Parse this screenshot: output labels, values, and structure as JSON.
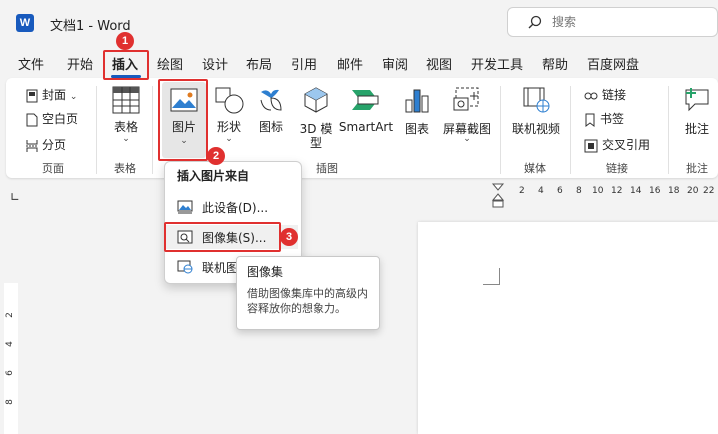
{
  "app": {
    "logo_letter": "W",
    "title": "文档1  -  Word",
    "search_placeholder": "搜索"
  },
  "tabs": [
    "文件",
    "开始",
    "插入",
    "绘图",
    "设计",
    "布局",
    "引用",
    "邮件",
    "审阅",
    "视图",
    "开发工具",
    "帮助",
    "百度网盘"
  ],
  "active_tab": "插入",
  "ribbon": {
    "pages_group": {
      "cover": "封面",
      "blank": "空白页",
      "break": "分页",
      "label": "页面"
    },
    "table_group": {
      "table": "表格",
      "label": "表格"
    },
    "illustrations_group": {
      "pictures": "图片",
      "shapes": "形状",
      "icons": "图标",
      "model3d_line1": "3D 模",
      "model3d_line2": "型",
      "smartart": "SmartArt",
      "chart": "图表",
      "screenshot": "屏幕截图",
      "label": "插图"
    },
    "media_group": {
      "online_video": "联机视频",
      "label": "媒体"
    },
    "links_group": {
      "link": "链接",
      "bookmark": "书签",
      "cross_ref": "交叉引用",
      "label": "链接"
    },
    "comments_group": {
      "comment": "批注",
      "label": "批注"
    }
  },
  "ruler": {
    "top": [
      "2",
      "4",
      "6",
      "8",
      "10",
      "12",
      "14",
      "16",
      "18",
      "20",
      "22"
    ],
    "left": [
      "2",
      "4",
      "6",
      "8"
    ]
  },
  "dropdown": {
    "header": "插入图片来自",
    "items": [
      "此设备(D)...",
      "图像集(S)...",
      "联机图"
    ]
  },
  "tooltip": {
    "title": "图像集",
    "description": "借助图像集库中的高级内容释放你的想象力。"
  },
  "annotations": [
    "1",
    "2",
    "3"
  ],
  "colors": {
    "accent": "#185abd",
    "callout": "#e0302f"
  }
}
